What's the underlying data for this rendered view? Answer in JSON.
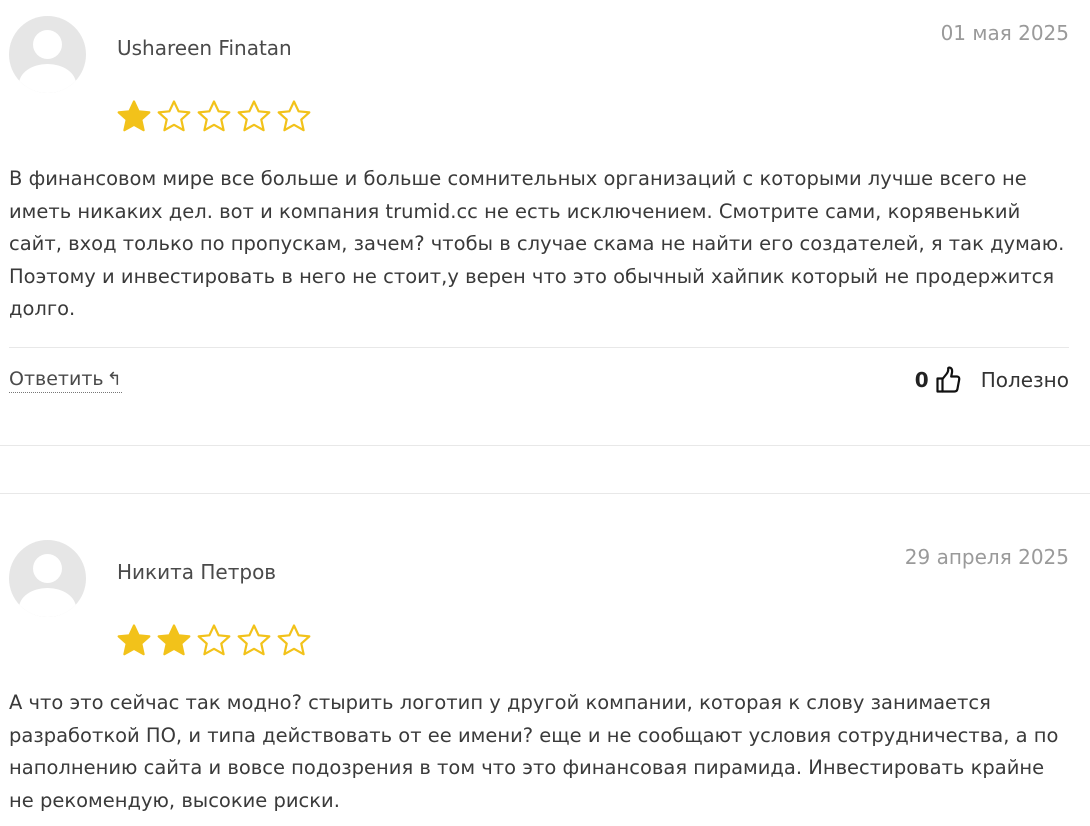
{
  "reviews": [
    {
      "author": "Ushareen Finatan",
      "date": "01 мая 2025",
      "rating": 1,
      "max_rating": 5,
      "text": "В финансовом мире все больше и больше сомнительных организаций с которыми лучше всего не иметь никаких дел. вот и компания trumid.cc не есть исключением. Смотрите сами, корявенький сайт, вход только по пропускам, зачем? чтобы в случае скама не найти его создателей, я так думаю. Поэтому и инвестировать в него не стоит,у верен что это обычный хайпик который не продержится долго.",
      "reply_label": "Ответить",
      "reply_icon": "reply-arrow-icon",
      "likes": "0",
      "like_icon": "thumbs-up-icon",
      "helpful_label": "Полезно"
    },
    {
      "author": "Никита Петров",
      "date": "29 апреля 2025",
      "rating": 2,
      "max_rating": 5,
      "text": "А что это сейчас так модно? стырить логотип у другой компании, которая к слову занимается разработкой ПО, и типа действовать от ее имени? еще и не сообщают условия сотрудничества, а по наполнению сайта и вовсе подозрения в том что это финансовая пирамида. Инвестировать крайне не рекомендую, высокие риски."
    }
  ],
  "colors": {
    "star_filled": "#f2c21a",
    "star_empty_outline": "#f2c21a",
    "avatar_bg": "#e6e6e6",
    "date_text": "#9a9a9a"
  }
}
